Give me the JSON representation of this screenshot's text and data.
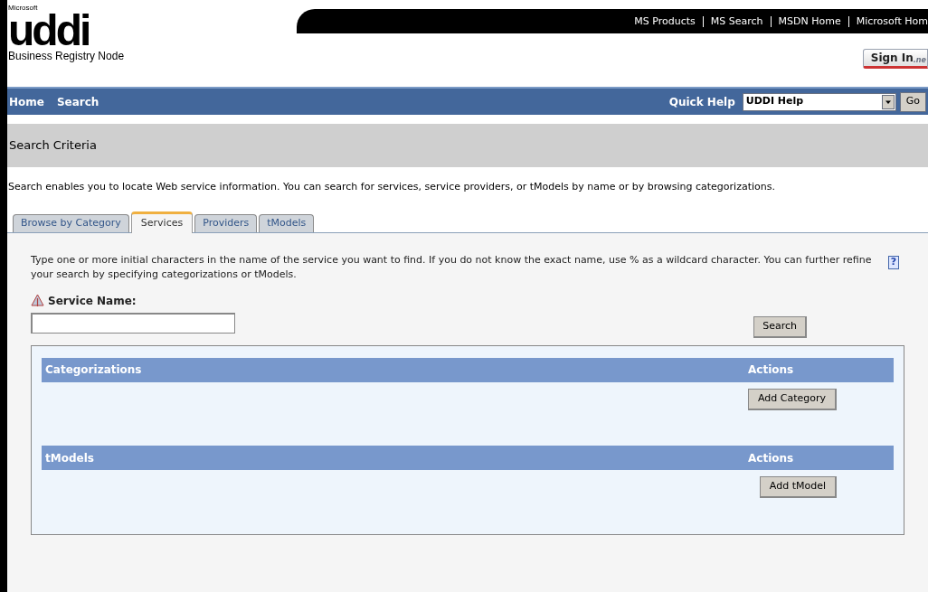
{
  "brand": {
    "company": "Microsoft",
    "logo": "uddi",
    "subtitle": "Business Registry Node"
  },
  "top_links": [
    "MS Products",
    "MS Search",
    "MSDN Home",
    "Microsoft Hom"
  ],
  "sign_in": {
    "label": "Sign In",
    "suffix": ".ne"
  },
  "nav": [
    {
      "label": "Home"
    },
    {
      "label": "Search"
    }
  ],
  "quick_help": {
    "label": "Quick Help",
    "value": "UDDI Help",
    "go": "Go"
  },
  "section_title": "Search Criteria",
  "intro": "Search enables you to locate Web service information. You can search for services, service providers, or tModels by name or by browsing categorizations.",
  "tabs": [
    {
      "label": "Browse by Category",
      "selected": false
    },
    {
      "label": "Services",
      "selected": true
    },
    {
      "label": "Providers",
      "selected": false
    },
    {
      "label": "tModels",
      "selected": false
    }
  ],
  "instructions": "Type one or more initial characters in the name of the service you want to find. If you do not know the exact name, use % as a wildcard character. You can further refine your search by specifying categorizations or tModels.",
  "help_icon": "?",
  "service_name": {
    "label": "Service Name:",
    "required": true
  },
  "search_button": "Search",
  "groups": [
    {
      "title": "Categorizations",
      "actions_label": "Actions",
      "button": "Add Category"
    },
    {
      "title": "tModels",
      "actions_label": "Actions",
      "button": "Add tModel"
    }
  ]
}
